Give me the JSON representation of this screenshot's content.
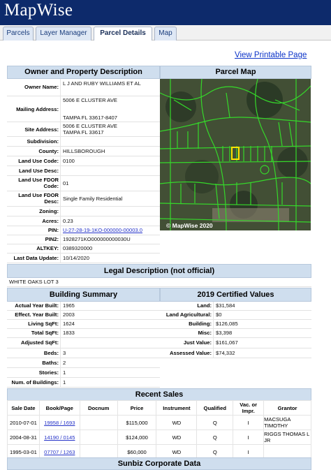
{
  "header": {
    "logo": "MapWise"
  },
  "tabs": [
    {
      "label": "Parcels"
    },
    {
      "label": "Layer Manager"
    },
    {
      "label": "Parcel Details"
    },
    {
      "label": "Map"
    }
  ],
  "print_link": "View Printable Page",
  "owner_section": {
    "title": "Owner and Property Description",
    "fields": [
      {
        "label": "Owner Name:",
        "value": "L J AND RUBY WILLIAMS ET AL"
      },
      {
        "label": "Mailing Address:",
        "value": "5006 E CLUSTER AVE",
        "value2": "TAMPA FL 33617-8407"
      },
      {
        "label": "Site Address:",
        "value": "5006 E CLUSTER AVE",
        "value2": "TAMPA FL 33617"
      },
      {
        "label": "Subdivision:",
        "value": ""
      },
      {
        "label": "County:",
        "value": "HILLSBOROUGH"
      },
      {
        "label": "Land Use Code:",
        "value": "0100"
      },
      {
        "label": "Land Use Desc:",
        "value": ""
      },
      {
        "label": "Land Use FDOR Code:",
        "value": "01"
      },
      {
        "label": "Land Use FDOR Desc:",
        "value": "Single Family Residential"
      },
      {
        "label": "Zoning:",
        "value": ""
      },
      {
        "label": "Acres:",
        "value": "0.23"
      },
      {
        "label": "PIN:",
        "value": "U-27-28-19-1KO-000000-00003.0"
      },
      {
        "label": "PIN2:",
        "value": "1928271KO000000000030U"
      },
      {
        "label": "ALTKEY:",
        "value": "0389320000"
      },
      {
        "label": "Last Data Update:",
        "value": "10/14/2020"
      }
    ]
  },
  "map_section": {
    "title": "Parcel Map",
    "credit": "© MapWise 2020"
  },
  "legal": {
    "title": "Legal Description (not official)",
    "text": "WHITE OAKS LOT 3"
  },
  "building": {
    "title": "Building Summary",
    "fields": [
      {
        "label": "Actual Year Built:",
        "value": "1965"
      },
      {
        "label": "Effect. Year Built:",
        "value": "2003"
      },
      {
        "label": "Living SqFt:",
        "value": "1624"
      },
      {
        "label": "Total SqFt:",
        "value": "1833"
      },
      {
        "label": "Adjusted SqFt:",
        "value": ""
      },
      {
        "label": "Beds:",
        "value": "3"
      },
      {
        "label": "Baths:",
        "value": "2"
      },
      {
        "label": "Stories:",
        "value": "1"
      },
      {
        "label": "Num. of Buildings:",
        "value": "1"
      }
    ]
  },
  "certified": {
    "title": "2019 Certified Values",
    "fields": [
      {
        "label": "Land:",
        "value": "$31,584"
      },
      {
        "label": "Land Agricultural:",
        "value": "$0"
      },
      {
        "label": "Building:",
        "value": "$126,085"
      },
      {
        "label": "Misc:",
        "value": "$3,398"
      },
      {
        "label": "Just Value:",
        "value": "$161,067"
      },
      {
        "label": "Assessed Value:",
        "value": "$74,332"
      }
    ]
  },
  "sales": {
    "title": "Recent Sales",
    "columns": [
      "Sale Date",
      "Book/Page",
      "Docnum",
      "Price",
      "Instrument",
      "Qualified",
      "Vac. or Impr.",
      "Grantor"
    ],
    "rows": [
      {
        "date": "2010-07-01",
        "book": "19958 / 1693",
        "docnum": "",
        "price": "$115,000",
        "instrument": "WD",
        "qualified": "Q",
        "vac": "I",
        "grantor": "MACSUGA TIMOTHY"
      },
      {
        "date": "2004-08-31",
        "book": "14190 / 0145",
        "docnum": "",
        "price": "$124,000",
        "instrument": "WD",
        "qualified": "Q",
        "vac": "I",
        "grantor": "RIGGS THOMAS L JR"
      },
      {
        "date": "1995-03-01",
        "book": "07707 / 1263",
        "docnum": "",
        "price": "$60,000",
        "instrument": "WD",
        "qualified": "Q",
        "vac": "I",
        "grantor": ""
      }
    ]
  },
  "sunbiz": {
    "title": "Sunbiz Corporate Data"
  }
}
